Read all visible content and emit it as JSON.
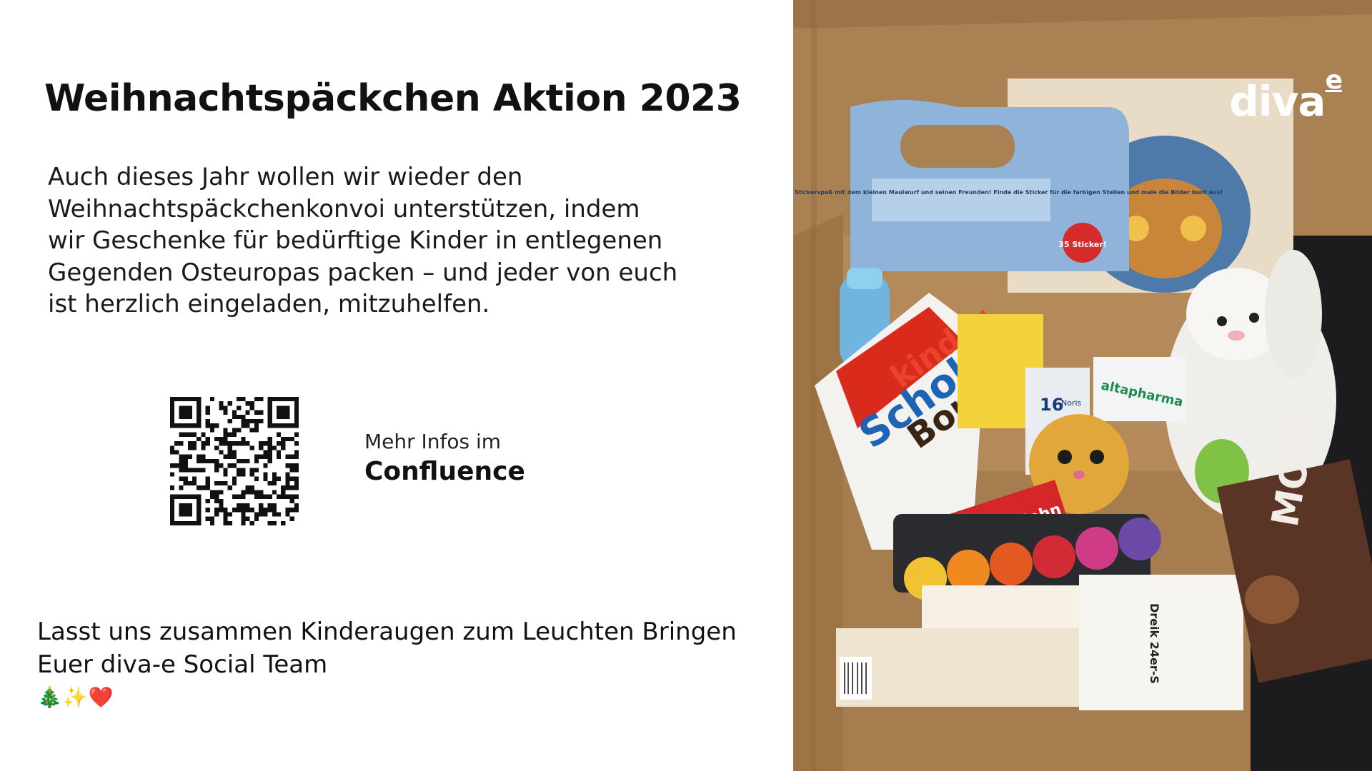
{
  "slide": {
    "title": "Weihnachtspäckchen Aktion 2023",
    "intro_lines": [
      "Auch dieses Jahr wollen wir wieder den",
      "Weihnachtspäckchenkonvoi unterstützen, indem",
      "wir Geschenke für bedürftige Kinder in entlegenen",
      "Gegenden Osteuropas packen – und jeder von euch",
      "ist herzlich eingeladen, mitzuhelfen."
    ],
    "info": {
      "line1": "Mehr Infos im",
      "line2": "Confluence"
    },
    "closing": {
      "line1": "Lasst uns zusammen Kinderaugen zum Leuchten Bringen",
      "line2": "Euer diva-e Social Team",
      "emojis": "🎄✨❤️"
    },
    "logo": {
      "text": "diva",
      "superscript": "e"
    },
    "photo_labels": {
      "kinder_brand": "kinder",
      "kinder_product": "Schoko",
      "kinder_product2": "Bons",
      "pencils_count": "16",
      "pencils_name": "Noris",
      "pharma": "altapharma",
      "sticker_badge": "35 Sticker!",
      "book_text": "Ein winterlicher Ausmal- und Stickerspaß mit dem kleinen Maulwurf und seinen Freunden! Finde die Sticker für die farbigen Stellen und male die Bilder bunt aus!",
      "crayons": "Dreik 24er-S",
      "moo": "MOO",
      "milch": "Milch Sahn"
    }
  }
}
